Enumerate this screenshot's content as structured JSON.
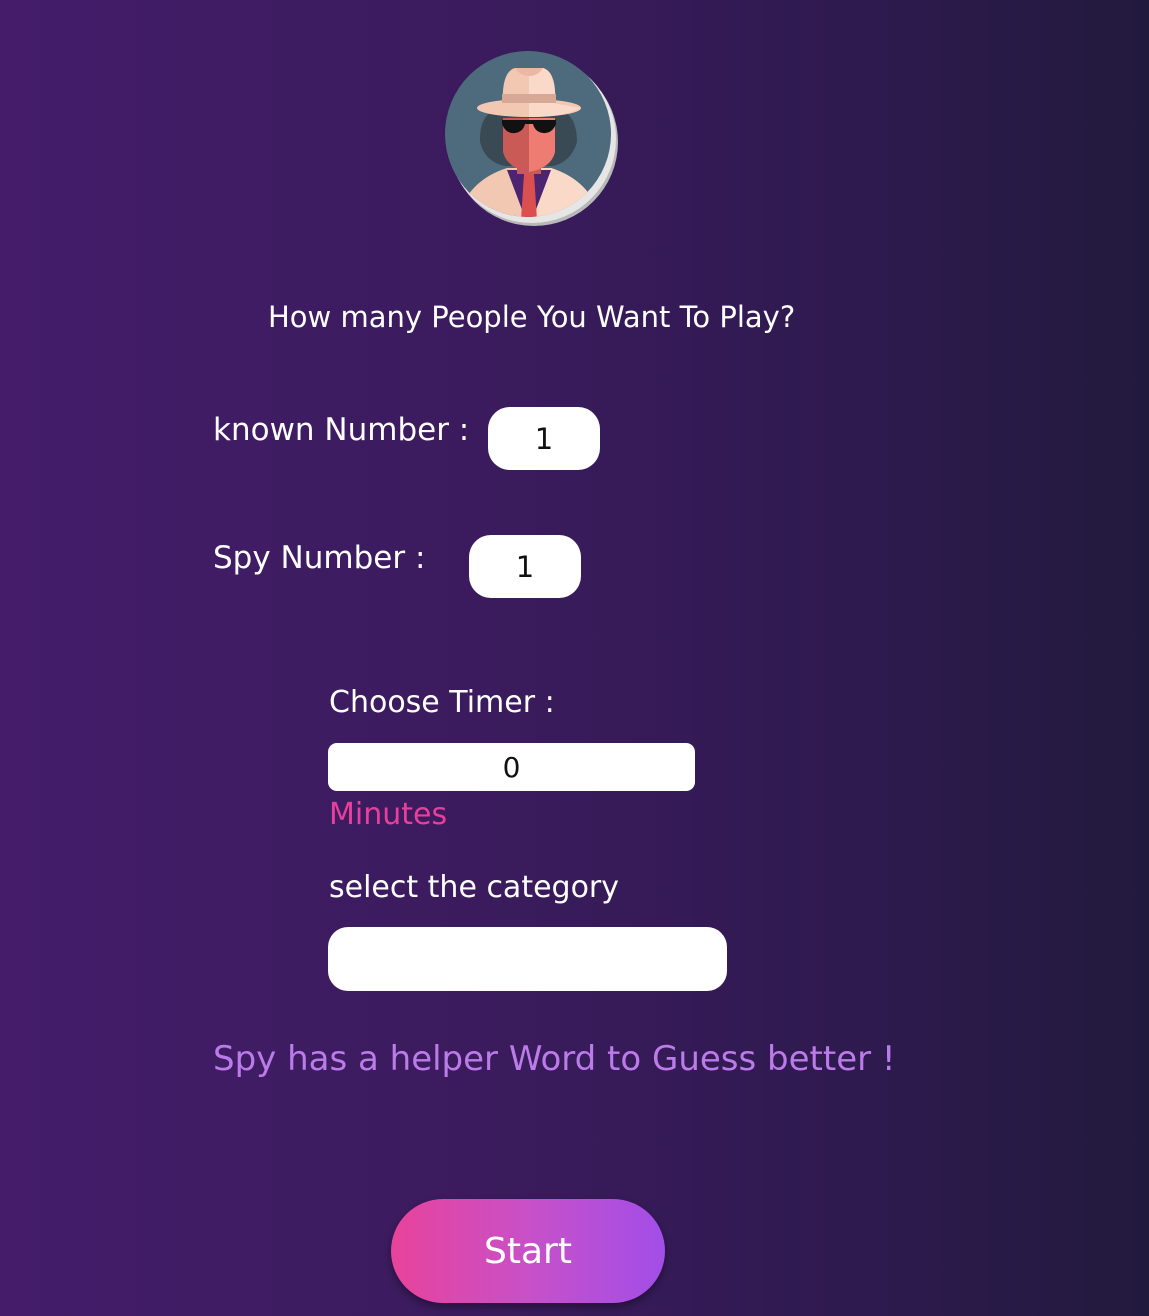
{
  "avatar": {
    "icon": "spy-avatar-icon"
  },
  "question": "How many People You Want To Play?",
  "known": {
    "label": "known Number :",
    "value": "1"
  },
  "spy": {
    "label": "Spy Number :",
    "value": "1"
  },
  "timer": {
    "label": "Choose Timer :",
    "value": "0",
    "unit": "Minutes"
  },
  "category": {
    "label": "select the category",
    "value": ""
  },
  "helper_text": "Spy has a helper Word to Guess better !",
  "start_label": "Start",
  "colors": {
    "accent_pink": "#e8409a",
    "helper_purple": "#bb7be8",
    "button_gradient_start": "#e8439a",
    "button_gradient_end": "#a24ee8"
  }
}
